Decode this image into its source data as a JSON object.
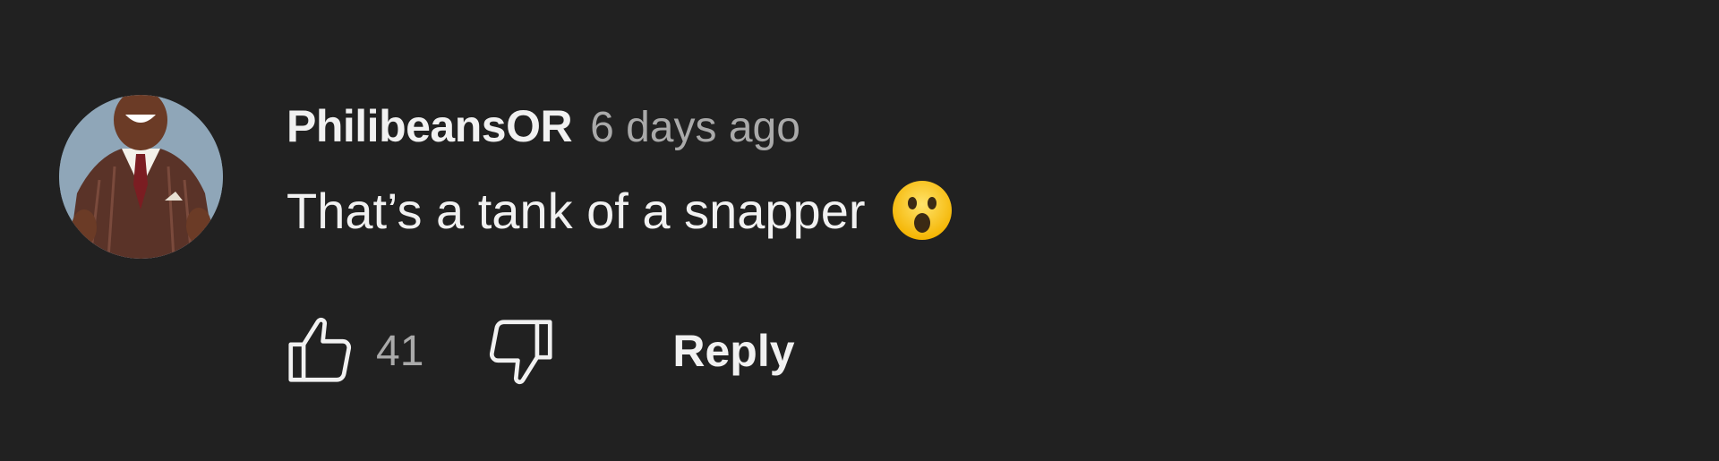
{
  "comment": {
    "author": "PhilibeansOR",
    "timestamp": "6 days ago",
    "text": "That’s a tank of a snapper",
    "emoji": "astonished-face",
    "avatar": "avatar-man-in-suit"
  },
  "actions": {
    "like_icon": "thumbs-up-icon",
    "like_count": "41",
    "dislike_icon": "thumbs-down-icon",
    "reply_label": "Reply"
  },
  "colors": {
    "background": "#212121",
    "primary_text": "#f1f1f1",
    "secondary_text": "#aaaaaa"
  }
}
